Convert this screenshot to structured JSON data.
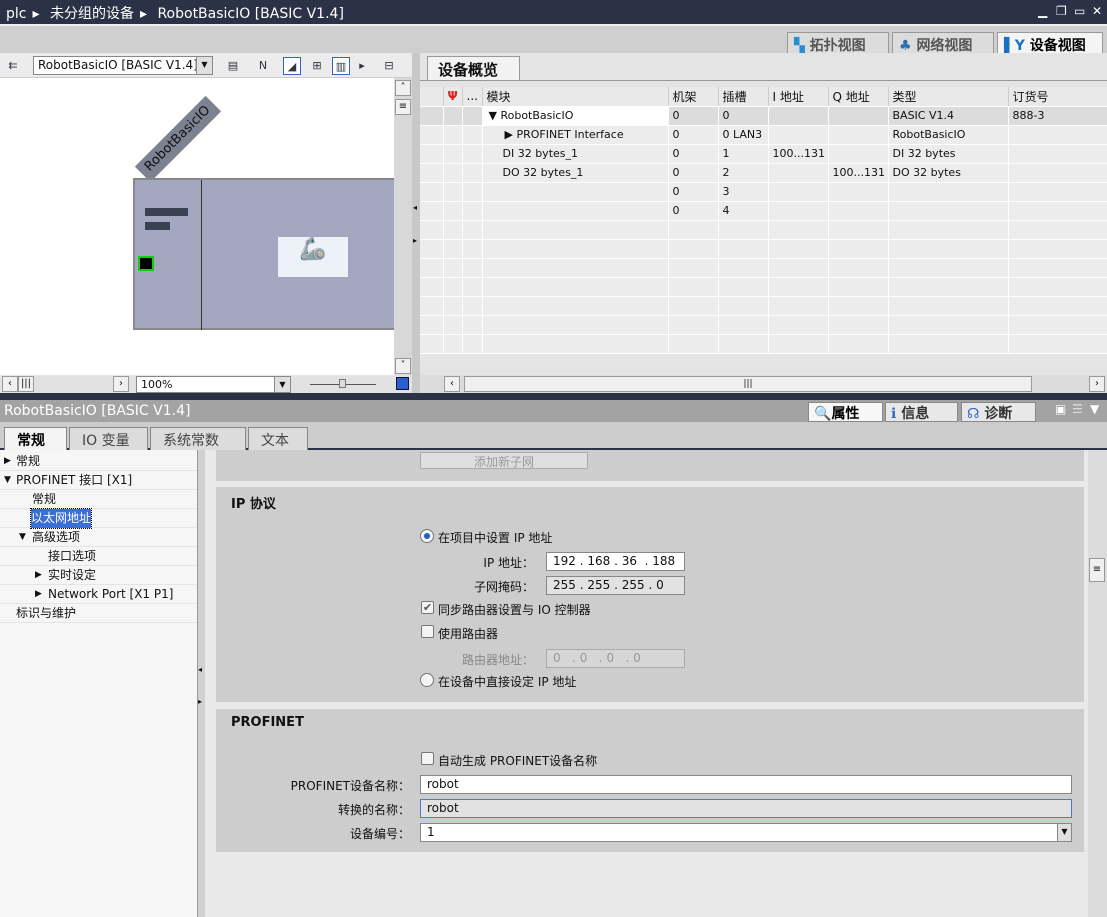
{
  "breadcrumb": [
    "plc",
    "未分组的设备",
    "RobotBasicIO [BASIC V1.4]"
  ],
  "view_tabs": [
    "拓扑视图",
    "网络视图",
    "设备视图"
  ],
  "left_toolbar": {
    "device_select": "RobotBasicIO [BASIC V1.4]"
  },
  "canvas": {
    "device_label": "RobotBasicIO",
    "zoom": "100%"
  },
  "overview": {
    "tab": "设备概览",
    "headers": [
      "...",
      "模块",
      "机架",
      "插槽",
      "I 地址",
      "Q 地址",
      "类型",
      "订货号"
    ],
    "rows": [
      {
        "module": "RobotBasicIO",
        "rack": "0",
        "slot": "0",
        "i": "",
        "q": "",
        "type": "BASIC V1.4",
        "order": "888-3"
      },
      {
        "module": "PROFINET Interface",
        "rack": "0",
        "slot": "0 LAN3",
        "i": "",
        "q": "",
        "type": "RobotBasicIO",
        "order": ""
      },
      {
        "module": "DI 32 bytes_1",
        "rack": "0",
        "slot": "1",
        "i": "100...131",
        "q": "",
        "type": "DI 32 bytes",
        "order": ""
      },
      {
        "module": "DO 32 bytes_1",
        "rack": "0",
        "slot": "2",
        "i": "",
        "q": "100...131",
        "type": "DO 32 bytes",
        "order": ""
      },
      {
        "module": "",
        "rack": "0",
        "slot": "3",
        "i": "",
        "q": "",
        "type": "",
        "order": ""
      },
      {
        "module": "",
        "rack": "0",
        "slot": "4",
        "i": "",
        "q": "",
        "type": "",
        "order": ""
      }
    ]
  },
  "inspector": {
    "title": "RobotBasicIO [BASIC V1.4]",
    "tabs": [
      "属性",
      "信息",
      "诊断"
    ],
    "prop_tabs": [
      "常规",
      "IO 变量",
      "系统常数",
      "文本"
    ],
    "tree": [
      "常规",
      "PROFINET 接口 [X1]",
      "常规",
      "以太网地址",
      "高级选项",
      "接口选项",
      "实时设定",
      "Network Port [X1 P1]",
      "标识与维护"
    ]
  },
  "form": {
    "add_subnet": "添加新子网",
    "ip_section": "IP 协议",
    "set_in_project": "在项目中设置 IP 地址",
    "ip_label": "IP 地址：",
    "ip": [
      "192",
      "168",
      "36",
      "188"
    ],
    "mask_label": "子网掩码：",
    "mask": [
      "255",
      "255",
      "255",
      "0"
    ],
    "sync_router": "同步路由器设置与 IO 控制器",
    "use_router": "使用路由器",
    "router_label": "路由器地址：",
    "router": [
      "0",
      "0",
      "0",
      "0"
    ],
    "set_in_device": "在设备中直接设定 IP 地址",
    "pn_section": "PROFINET",
    "auto_name": "自动生成 PROFINET设备名称",
    "name_label": "PROFINET设备名称：",
    "name": "robot",
    "conv_label": "转换的名称：",
    "conv": "robot",
    "num_label": "设备编号：",
    "num": "1"
  }
}
